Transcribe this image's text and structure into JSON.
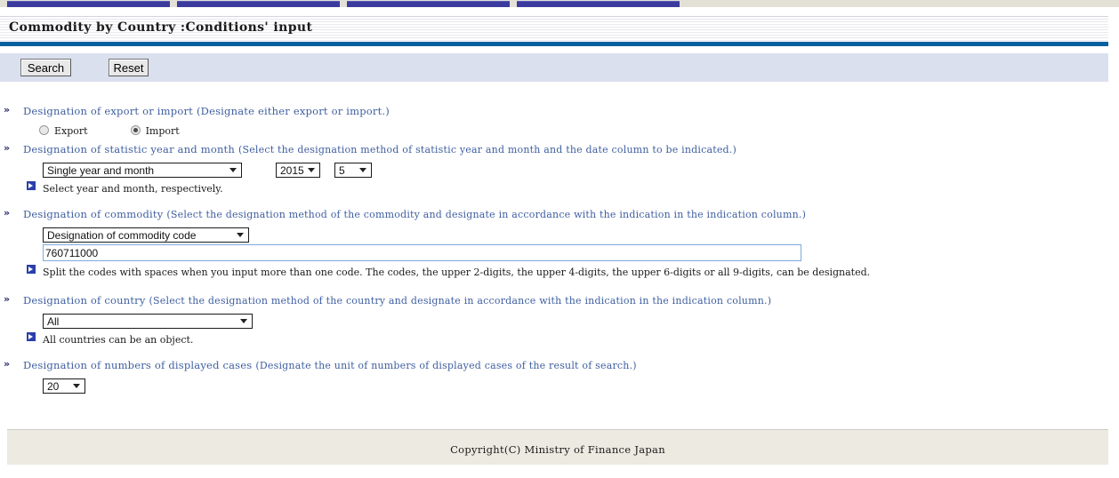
{
  "topbar": {
    "tabs": [
      "tab-1",
      "tab-2",
      "tab-3",
      "tab-4"
    ]
  },
  "header": {
    "title": "Commodity by Country :Conditions' input"
  },
  "toolbar": {
    "search_label": "Search",
    "reset_label": "Reset"
  },
  "sections": {
    "trade_direction": {
      "bullet": "»",
      "label": "Designation of export or import",
      "note": "(Designate either export or import.)",
      "options": [
        {
          "label": "Export",
          "selected": false
        },
        {
          "label": "Import",
          "selected": true
        }
      ]
    },
    "period": {
      "bullet": "»",
      "label": "Designation of statistic year and month",
      "note": "(Select the designation method of statistic year and month and the date column to be indicated.)",
      "method_value": "Single year and month",
      "year_value": "2015",
      "month_value": "5",
      "hint": "Select year and month, respectively."
    },
    "commodity": {
      "bullet": "»",
      "label": "Designation of commodity",
      "note": "(Select the designation method of the commodity and designate in accordance with the indication in the indication column.)",
      "method_value": "Designation of commodity code",
      "code_value": "760711000",
      "code_placeholder": "",
      "hint": "Split the codes with spaces when you input more than one code. The codes, the upper 2-digits, the upper 4-digits, the upper 6-digits or all 9-digits, can be designated."
    },
    "country": {
      "bullet": "»",
      "label": "Designation of country",
      "note": "(Select the designation method of the country and designate in accordance with the indication in the indication column.)",
      "method_value": "All",
      "hint": "All countries can be an object."
    },
    "cases": {
      "bullet": "»",
      "label": "Designation of numbers of displayed cases",
      "note": "(Designate the unit of numbers of displayed cases of the result of search.)",
      "count_value": "20"
    }
  },
  "footer": {
    "copyright": "Copyright(C) Ministry of Finance Japan"
  },
  "colors": {
    "accent_blue": "#00619e",
    "tab_blue": "#3b3b9e",
    "label_blue": "#3f5fa0",
    "button_bar": "#dbe0ee",
    "footer_bg": "#eceae1",
    "focus_border": "#7eaada"
  }
}
